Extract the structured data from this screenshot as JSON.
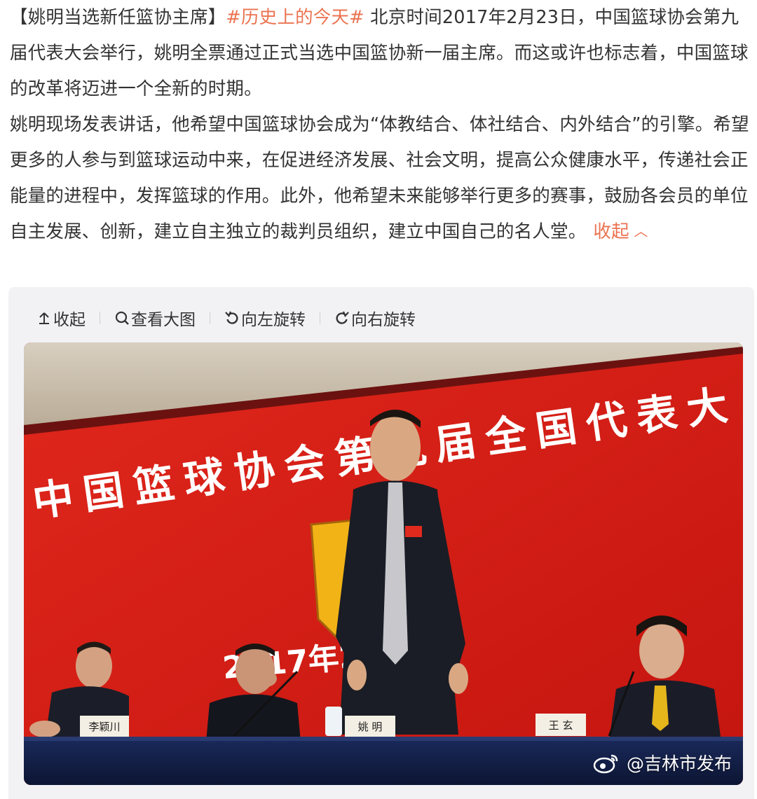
{
  "post": {
    "clipped_top_line": "...",
    "paragraph1_prefix": "【姚明当选新任篮协主席】",
    "topic_tag": "#历史上的今天#",
    "paragraph1_rest": " 北京时间2017年2月23日，中国篮球协会第九届代表大会举行，姚明全票通过正式当选中国篮协新一届主席。而这或许也标志着，中国篮球的改革将迈进一个全新的时期。",
    "paragraph2": "姚明现场发表讲话，他希望中国篮球协会成为“体教结合、体社结合、内外结合”的引擎。希望更多的人参与到篮球运动中来，在促进经济发展、社会文明，提高公众健康水平，传递社会正能量的进程中，发挥篮球的作用。此外，他希望未来能够举行更多的赛事，鼓励各会员的单位自主发展、创新，建立自主独立的裁判员组织，建立中国自己的名人堂。",
    "collapse_label": "收起",
    "collapse_icon": "chevron-up-icon"
  },
  "toolbar": {
    "collapse": {
      "label": "收起",
      "icon": "arrow-up-icon"
    },
    "view_large": {
      "label": "查看大图",
      "icon": "magnifier-icon"
    },
    "rotate_left": {
      "label": "向左旋转",
      "icon": "rotate-left-icon"
    },
    "rotate_right": {
      "label": "向右旋转",
      "icon": "rotate-right-icon"
    }
  },
  "photo": {
    "banner_text": "中国篮球协会第九届全国代表大",
    "date_text": "2017年2月",
    "nameplates": [
      "李颖川",
      "姚 明",
      "王 玄"
    ],
    "watermark": "@吉林市发布",
    "watermark_icon": "weibo-logo-icon"
  },
  "colors": {
    "accent": "#eb7350",
    "text": "#333333",
    "card_bg": "#f2f2f5",
    "banner_red": "#d61f17"
  }
}
